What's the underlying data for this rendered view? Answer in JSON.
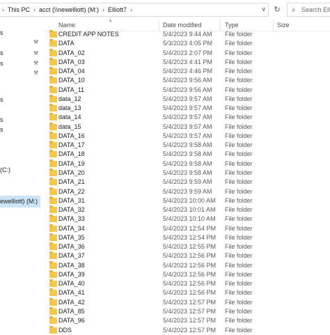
{
  "address": {
    "crumbs": [
      "This PC",
      "acct (\\\\newelliott) (M:)",
      "Elliott7"
    ],
    "separator": ">"
  },
  "search": {
    "placeholder": "Search Ellio"
  },
  "columns": {
    "name": "Name",
    "date": "Date modified",
    "type": "Type",
    "size": "Size"
  },
  "nav": {
    "drive_c": "(C:)",
    "selected_drive": "ewelliott) (M:)"
  },
  "files": [
    {
      "name": "CREDIT APP NOTES",
      "date": "5/4/2023 9:44 AM",
      "type": "File folder"
    },
    {
      "name": "DATA",
      "date": "5/3/2023 4:05 PM",
      "type": "File folder"
    },
    {
      "name": "DATA_02",
      "date": "5/4/2023 2:07 PM",
      "type": "File folder"
    },
    {
      "name": "DATA_03",
      "date": "5/4/2023 4:41 PM",
      "type": "File folder"
    },
    {
      "name": "DATA_04",
      "date": "5/4/2023 4:46 PM",
      "type": "File folder"
    },
    {
      "name": "DATA_10",
      "date": "5/4/2023 9:56 AM",
      "type": "File folder"
    },
    {
      "name": "DATA_11",
      "date": "5/4/2023 9:56 AM",
      "type": "File folder"
    },
    {
      "name": "data_12",
      "date": "5/4/2023 9:57 AM",
      "type": "File folder"
    },
    {
      "name": "data_13",
      "date": "5/4/2023 9:57 AM",
      "type": "File folder"
    },
    {
      "name": "data_14",
      "date": "5/4/2023 9:57 AM",
      "type": "File folder"
    },
    {
      "name": "data_15",
      "date": "5/4/2023 9:57 AM",
      "type": "File folder"
    },
    {
      "name": "DATA_16",
      "date": "5/4/2023 9:57 AM",
      "type": "File folder"
    },
    {
      "name": "DATA_17",
      "date": "5/4/2023 9:58 AM",
      "type": "File folder"
    },
    {
      "name": "DATA_18",
      "date": "5/4/2023 9:58 AM",
      "type": "File folder"
    },
    {
      "name": "DATA_19",
      "date": "5/4/2023 9:58 AM",
      "type": "File folder"
    },
    {
      "name": "DATA_20",
      "date": "5/4/2023 9:58 AM",
      "type": "File folder"
    },
    {
      "name": "DATA_21",
      "date": "5/4/2023 9:59 AM",
      "type": "File folder"
    },
    {
      "name": "DATA_22",
      "date": "5/4/2023 9:59 AM",
      "type": "File folder"
    },
    {
      "name": "DATA_31",
      "date": "5/4/2023 10:00 AM",
      "type": "File folder"
    },
    {
      "name": "DATA_32",
      "date": "5/4/2023 10:01 AM",
      "type": "File folder"
    },
    {
      "name": "DATA_33",
      "date": "5/4/2023 10:10 AM",
      "type": "File folder"
    },
    {
      "name": "DATA_34",
      "date": "5/4/2023 12:54 PM",
      "type": "File folder"
    },
    {
      "name": "DATA_35",
      "date": "5/4/2023 12:54 PM",
      "type": "File folder"
    },
    {
      "name": "DATA_36",
      "date": "5/4/2023 12:55 PM",
      "type": "File folder"
    },
    {
      "name": "DATA_37",
      "date": "5/4/2023 12:56 PM",
      "type": "File folder"
    },
    {
      "name": "DATA_38",
      "date": "5/4/2023 12:56 PM",
      "type": "File folder"
    },
    {
      "name": "DATA_39",
      "date": "5/4/2023 12:56 PM",
      "type": "File folder"
    },
    {
      "name": "DATA_40",
      "date": "5/4/2023 12:56 PM",
      "type": "File folder"
    },
    {
      "name": "DATA_41",
      "date": "5/4/2023 12:56 PM",
      "type": "File folder"
    },
    {
      "name": "DATA_42",
      "date": "5/4/2023 12:57 PM",
      "type": "File folder"
    },
    {
      "name": "DATA_85",
      "date": "5/4/2023 12:57 PM",
      "type": "File folder"
    },
    {
      "name": "DATA_96",
      "date": "5/4/2023 12:57 PM",
      "type": "File folder"
    },
    {
      "name": "DDS",
      "date": "5/4/2023 12:57 PM",
      "type": "File folder"
    }
  ]
}
